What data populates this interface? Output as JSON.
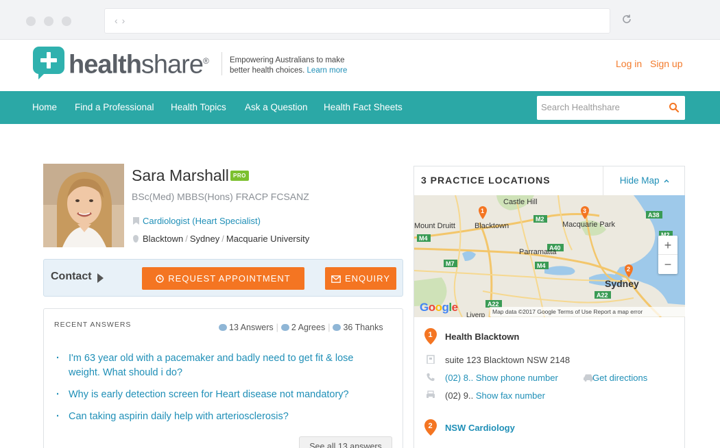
{
  "header": {
    "logo_text_bold": "health",
    "logo_text_light": "share",
    "logo_reg": "®",
    "tagline": "Empowering Australians to make better health choices.",
    "learn_more": "Learn more",
    "login": "Log in",
    "signup": "Sign up"
  },
  "nav": {
    "items": [
      "Home",
      "Find a Professional",
      "Health Topics",
      "Ask a Question",
      "Health Fact Sheets"
    ],
    "search_placeholder": "Search Healthshare"
  },
  "profile": {
    "name": "Sara Marshall",
    "badge": "PRO",
    "qualifications": "BSc(Med) MBBS(Hons) FRACP FCSANZ",
    "specialty": "Cardiologist (Heart Specialist)",
    "locations": [
      "Blacktown",
      "Sydney",
      "Macquarie University"
    ],
    "location_sep": "/"
  },
  "contact": {
    "label": "Contact",
    "request_appointment": "REQUEST APPOINTMENT",
    "enquiry": "ENQUIRY"
  },
  "recent_answers": {
    "heading": "RECENT ANSWERS",
    "answers_count": "13 Answers",
    "agrees_count": "2 Agrees",
    "thanks_count": "36 Thanks",
    "questions": [
      "I'm 63 year old with a pacemaker and badly need to get fit & lose weight. What should i do?",
      "Why is early detection screen for Heart disease not mandatory?",
      "Can taking aspirin daily help with arteriosclerosis?"
    ],
    "see_all": "See all 13 answers"
  },
  "practice": {
    "title": "3 PRACTICE LOCATIONS",
    "hide_map": "Hide Map",
    "map_labels": {
      "castle_hill": "Castle Hill",
      "mount_druitt": "Mount Druitt",
      "blacktown": "Blacktown",
      "macquarie_park": "Macquarie Park",
      "parramatta": "Parramatta",
      "sydney": "Sydney",
      "liverpool": "Liverp",
      "roads": [
        "M2",
        "A38",
        "M4",
        "A40",
        "M7",
        "M4",
        "A22",
        "A22",
        "M2"
      ]
    },
    "map_attr": "Map data ©2017 Google   Terms of Use   Report a map error",
    "google": "Google",
    "zoom_in": "+",
    "zoom_out": "−",
    "entries": [
      {
        "number": "1",
        "name": "Health Blacktown",
        "address": "suite 123 Blacktown NSW 2148",
        "phone_prefix": "(02) 8..",
        "phone_link": "Show phone number",
        "directions": "Get directions",
        "fax_prefix": "(02) 9..",
        "fax_link": "Show fax number"
      },
      {
        "number": "2",
        "name": "NSW Cardiology"
      }
    ]
  },
  "colors": {
    "teal": "#2ba8a6",
    "orange": "#f47522",
    "link_blue": "#1f8fb7",
    "pro_green": "#7cc02f"
  }
}
